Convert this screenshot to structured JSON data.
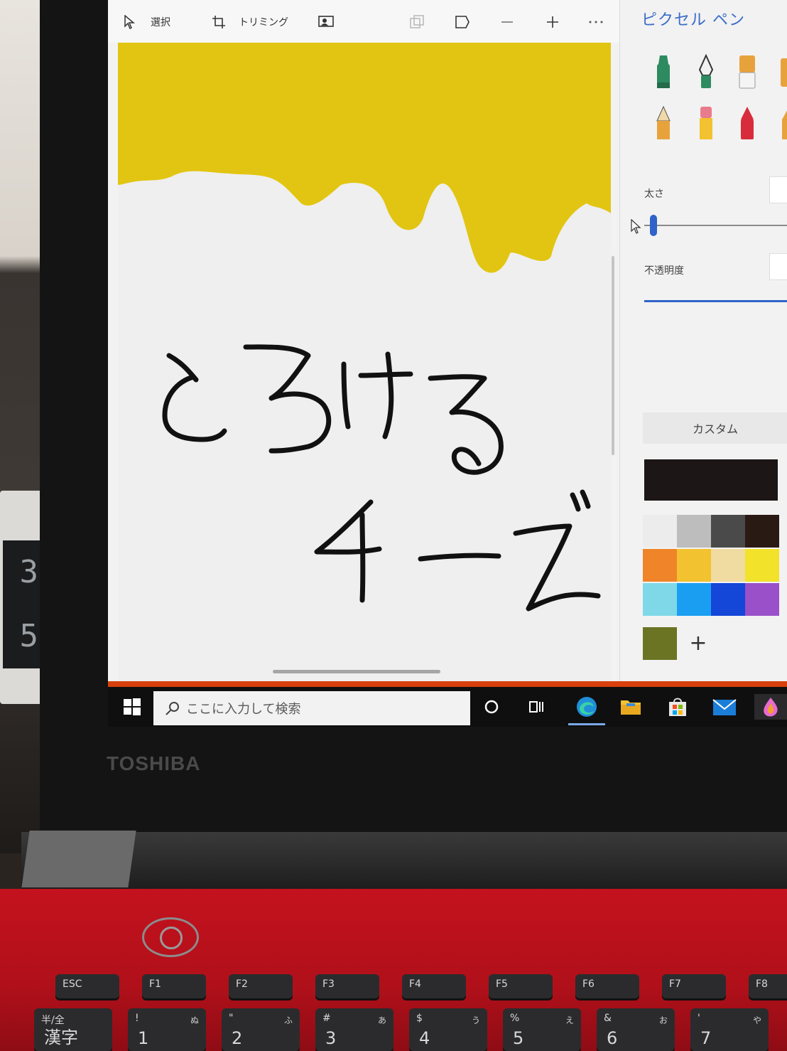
{
  "toolbar": {
    "select_label": "選択",
    "trim_label": "トリミング"
  },
  "panel": {
    "title": "ピクセル ペン",
    "thickness_label": "太さ",
    "opacity_label": "不透明度",
    "custom_label": "カスタム",
    "add_color_symbol": "+",
    "current_color": "#1d1616",
    "custom_swatch": "#6b7423",
    "palette": [
      [
        "#ececec",
        "#bdbdbd",
        "#4a4a4a",
        "#2a1a14"
      ],
      [
        "#f08428",
        "#f2c230",
        "#f0dca0",
        "#f2e22a"
      ],
      [
        "#7fd8e8",
        "#1a9ef2",
        "#1446d8",
        "#9a50c8"
      ]
    ]
  },
  "canvas": {
    "drip_color": "#e2c512",
    "ink_color": "#111111"
  },
  "taskbar": {
    "search_placeholder": "ここに入力して検索",
    "accent_color": "#d8400e"
  },
  "bezel": {
    "brand": "TOSHIBA"
  },
  "keyboard": {
    "fn_row": [
      "ESC",
      "F1",
      "F2",
      "F3",
      "F4",
      "F5",
      "F6",
      "F7",
      "F8"
    ],
    "num_row": [
      {
        "main": "半/全",
        "big": "漢字",
        "sub": ""
      },
      {
        "main": "!",
        "big": "1",
        "sub": "ぬ"
      },
      {
        "main": "\"",
        "big": "2",
        "sub": "ふ"
      },
      {
        "main": "#",
        "big": "3",
        "sub": "あ"
      },
      {
        "main": "$",
        "big": "4",
        "sub": "う"
      },
      {
        "main": "%",
        "big": "5",
        "sub": "え"
      },
      {
        "main": "&",
        "big": "6",
        "sub": "お"
      },
      {
        "main": "'",
        "big": "7",
        "sub": "や"
      }
    ]
  },
  "clock": {
    "top_digits": "3",
    "bottom_digits": "5"
  }
}
